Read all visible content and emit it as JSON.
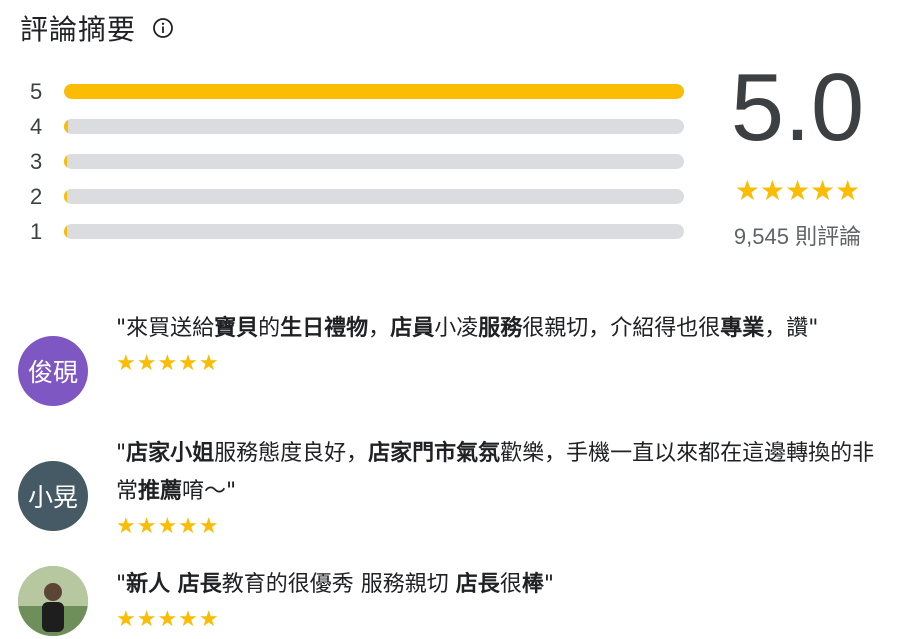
{
  "header": {
    "title": "評論摘要",
    "info_icon": "info-icon"
  },
  "distribution": [
    {
      "label": "5",
      "fraction": 1.0
    },
    {
      "label": "4",
      "fraction": 0.006
    },
    {
      "label": "3",
      "fraction": 0.003
    },
    {
      "label": "2",
      "fraction": 0.003
    },
    {
      "label": "1",
      "fraction": 0.003
    }
  ],
  "summary": {
    "score": "5.0",
    "stars": "★★★★★",
    "count": "9,545 則評論"
  },
  "colors": {
    "star": "#fbbc04",
    "track": "#dadce0"
  },
  "reviews": [
    {
      "avatar_text": "俊硯",
      "avatar_color": "#7e57c2",
      "segments": [
        {
          "t": "\"來買送給",
          "b": false
        },
        {
          "t": "寶貝",
          "b": true
        },
        {
          "t": "的",
          "b": false
        },
        {
          "t": "生日禮物",
          "b": true
        },
        {
          "t": "，",
          "b": false
        },
        {
          "t": "店員",
          "b": true
        },
        {
          "t": "小凌",
          "b": false
        },
        {
          "t": "服務",
          "b": true
        },
        {
          "t": "很親切，介紹得也很",
          "b": false
        },
        {
          "t": "專業",
          "b": true
        },
        {
          "t": "，讚\"",
          "b": false
        }
      ],
      "stars": "★★★★★"
    },
    {
      "avatar_text": "小晃",
      "avatar_color": "#455a64",
      "segments": [
        {
          "t": "\"",
          "b": false
        },
        {
          "t": "店家小姐",
          "b": true
        },
        {
          "t": "服務態度良好，",
          "b": false
        },
        {
          "t": "店家門市氣氛",
          "b": true
        },
        {
          "t": "歡樂，手機一直以來都在這邊轉換的非常",
          "b": false
        },
        {
          "t": "推薦",
          "b": true
        },
        {
          "t": "唷～\"",
          "b": false
        }
      ],
      "stars": "★★★★★"
    },
    {
      "avatar_text": "",
      "avatar_color": "#8aa07a",
      "segments": [
        {
          "t": "\"",
          "b": false
        },
        {
          "t": "新人 店長",
          "b": true
        },
        {
          "t": "教育的很優秀 服務親切 ",
          "b": false
        },
        {
          "t": "店長",
          "b": true
        },
        {
          "t": "很",
          "b": false
        },
        {
          "t": "棒",
          "b": true
        },
        {
          "t": "\"",
          "b": false
        }
      ],
      "stars": "★★★★★"
    }
  ]
}
